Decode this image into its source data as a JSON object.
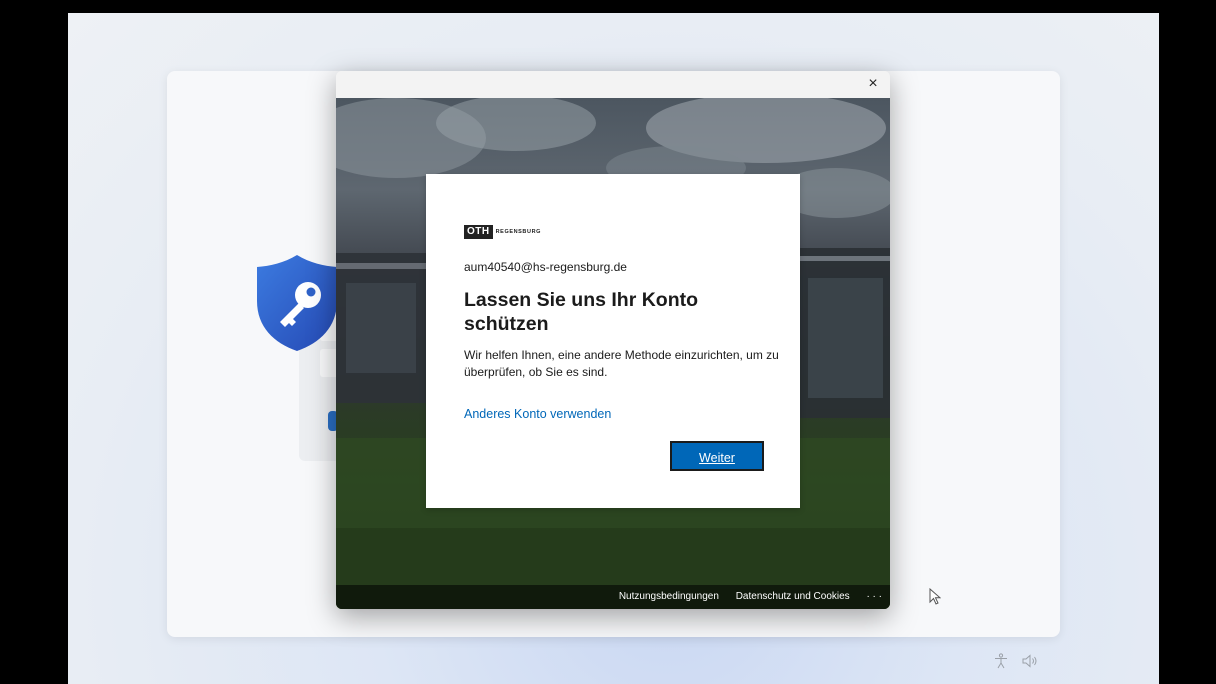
{
  "dialog": {
    "close_label": "×"
  },
  "login": {
    "logo_mark": "OTH",
    "logo_text": "REGENSBURG",
    "email": "aum40540@hs-regensburg.de",
    "title": "Lassen Sie uns Ihr Konto schützen",
    "description": "Wir helfen Ihnen, eine andere Methode einzurichten, um zu überprüfen, ob Sie es sind.",
    "other_account_link": "Anderes Konto verwenden",
    "next_button": "Weiter"
  },
  "footer": {
    "terms": "Nutzungsbedingungen",
    "privacy": "Datenschutz und Cookies",
    "more": "· · ·"
  },
  "icons": {
    "shield": "shield-key-icon",
    "close": "close-icon",
    "cursor": "mouse-cursor-icon",
    "accessibility": "accessibility-icon",
    "volume": "volume-icon"
  },
  "colors": {
    "accent": "#0067b8",
    "shield": "#2f62c8"
  }
}
